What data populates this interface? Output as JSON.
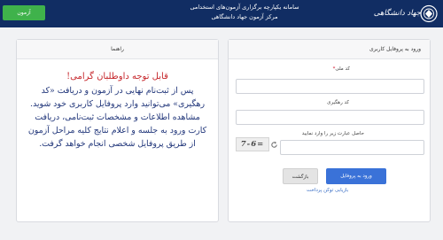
{
  "header": {
    "title_line1": "سامانه یکپارچه برگزاری آزمون‌های استخدامی",
    "title_line2": "مرکز آزمون جهاد دانشگاهی",
    "logo_text": "جهاد دانشگاهی",
    "exam_button": "آزمون"
  },
  "guide": {
    "heading": "راهنما",
    "title": "قابل توجه داوطلبان گرامی!",
    "lines": [
      "پس از ثبت‌نام نهایی در آزمون و دریافت «کد",
      "رهگیری» می‌توانید وارد پروفایل کاربری خود شوید.",
      "مشاهده اطلاعات و مشخصات ثبت‌نامی، دریافت",
      "کارت ورود به جلسه و اعلام نتایج کلیه مراحل آزمون",
      "از طریق پروفایل شخصی انجام خواهد گرفت."
    ]
  },
  "login": {
    "heading": "ورود به پروفایل کاربری",
    "national_code_label": "کد ملی",
    "required_mark": "*",
    "national_code_value": "",
    "tracking_code_label": "کد رهگیری",
    "tracking_code_value": "",
    "captcha_label": "حاصل عبارت زیر را وارد نمایید",
    "captcha_value": "",
    "captcha_text": "7-6=",
    "enter_button": "ورود به پروفایل",
    "back_button": "بازگشت",
    "recover_link": "بازیابی توکن پرداخت"
  }
}
